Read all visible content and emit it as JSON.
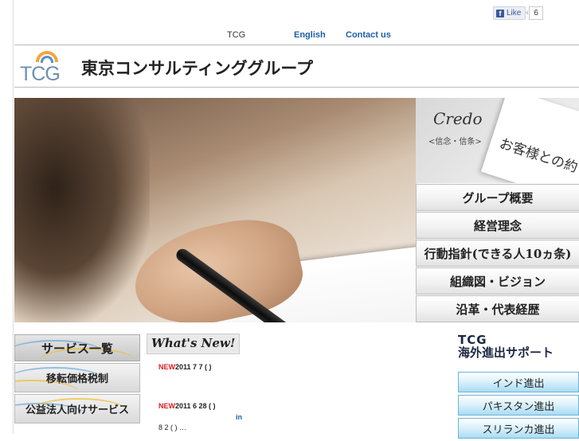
{
  "facebook": {
    "like_label": "Like",
    "like_count": "6",
    "f_glyph": "f"
  },
  "topnav": {
    "tcg": "TCG",
    "english": "English",
    "contact": "Contact us"
  },
  "header": {
    "logo_text": "TCG",
    "company_name": "東京コンサルティンググループ"
  },
  "credo": {
    "title": "Credo",
    "subtitle": "<信念・信条>",
    "card_text": "お客様との約"
  },
  "menu": {
    "items": [
      {
        "label": "グループ概要"
      },
      {
        "label": "経営理念"
      },
      {
        "label": "行動指針(できる人10ヵ条)"
      },
      {
        "label": "組織図・ビジョン"
      },
      {
        "label": "沿革・代表経歴"
      }
    ]
  },
  "services": {
    "heading": "サービス一覧",
    "items": [
      {
        "label": "移転価格税制"
      },
      {
        "label": "公益法人向けサービス"
      }
    ]
  },
  "whats_new": {
    "title": "What's New!",
    "news": [
      {
        "badge": "NEW",
        "date": "2011 7 7 ( )"
      },
      {
        "badge": "NEW",
        "date": "2011 6 28 ( )"
      }
    ],
    "link_fragment": "in",
    "third_line": "8 2 ( )          …"
  },
  "overseas": {
    "title_line1": "TCG",
    "title_line2": "海外進出サポート",
    "items": [
      {
        "label": "インド進出"
      },
      {
        "label": "パキスタン進出"
      },
      {
        "label": "スリランカ進出"
      }
    ]
  },
  "colors": {
    "link_blue": "#1f5fa8",
    "new_red": "#e21a1a",
    "logo_orange": "#f4a53a",
    "overseas_blue": "#a9dcf3"
  }
}
